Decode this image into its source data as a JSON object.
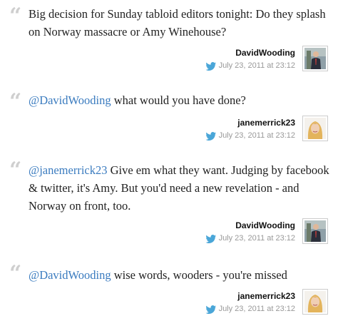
{
  "tweets": [
    {
      "mention": "",
      "body": "Big decision for Sunday tabloid editors tonight: Do they splash on Norway massacre or Amy Winehouse?",
      "username": "DavidWooding",
      "timestamp": "July 23, 2011 at 23:12",
      "avatar_icon": "avatar-man-suit"
    },
    {
      "mention": "@DavidWooding",
      "body": " what would you have done?",
      "username": "janemerrick23",
      "timestamp": "July 23, 2011 at 23:12",
      "avatar_icon": "avatar-woman-blonde"
    },
    {
      "mention": "@janemerrick23",
      "body": " Give em what they want. Judging by facebook & twitter, it's Amy. But you'd need a new revelation - and Norway on front, too.",
      "username": "DavidWooding",
      "timestamp": "July 23, 2011 at 23:12",
      "avatar_icon": "avatar-man-suit"
    },
    {
      "mention": "@DavidWooding",
      "body": " wise words, wooders - you're missed",
      "username": "janemerrick23",
      "timestamp": "July 23, 2011 at 23:12",
      "avatar_icon": "avatar-woman-blonde"
    }
  ],
  "colors": {
    "mention": "#3a7bbf",
    "quote_mark": "#cfcfcf",
    "timestamp": "#999999",
    "bird": "#4aa6d8"
  },
  "quote_glyph": "“"
}
